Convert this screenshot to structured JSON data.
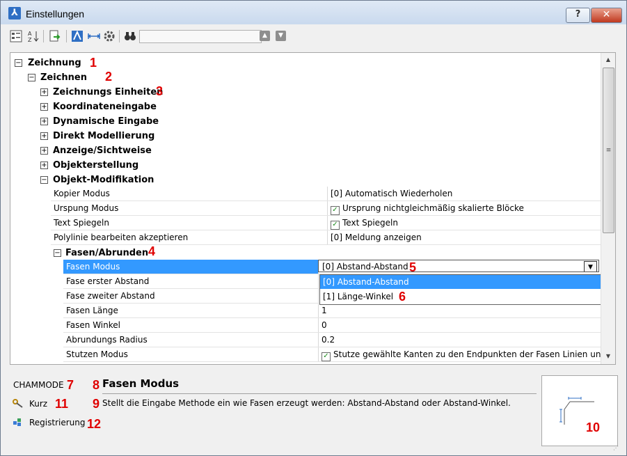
{
  "window": {
    "title": "Einstellungen",
    "help_label": "?",
    "close_label": "✕"
  },
  "toolbar": {
    "icons": [
      "categorized-view-icon",
      "alphabetic-sort-icon",
      "export-icon",
      "draw-settings-icon",
      "dimension-icon",
      "gear-icon",
      "binoculars-icon"
    ],
    "search_value": "",
    "up_label": "▲",
    "down_label": "▼"
  },
  "tree": {
    "zeichnung": "Zeichnung",
    "zeichnen": "Zeichnen",
    "zeichnungs_einheiten": "Zeichnungs Einheiten",
    "koordinateneingabe": "Koordinateneingabe",
    "dynamische_eingabe": "Dynamische Eingabe",
    "direkt_modellierung": "Direkt Modellierung",
    "anzeige": "Anzeige/Sichtweise",
    "objekterstellung": "Objekterstellung",
    "objekt_modifikation": "Objekt-Modifikation",
    "fasen_abrunden": "Fasen/Abrunden",
    "expanders": {
      "minus": "−",
      "plus": "+"
    }
  },
  "properties": {
    "kopier_modus": {
      "name": "Kopier Modus",
      "value": "[0] Automatisch Wiederholen"
    },
    "ursprung_modus": {
      "name": "Urspung Modus",
      "value": "Ursprung nichtgleichmäßig skalierte Blöcke",
      "checked": true
    },
    "text_spiegeln": {
      "name": "Text Spiegeln",
      "value": "Text Spiegeln",
      "checked": true
    },
    "polylinie": {
      "name": "Polylinie bearbeiten akzeptieren",
      "value": "[0] Meldung anzeigen"
    },
    "fasen_modus": {
      "name": "Fasen Modus",
      "value": "[0] Abstand-Abstand"
    },
    "fase_erster": {
      "name": "Fase erster Abstand",
      "value": ""
    },
    "fase_zweiter": {
      "name": "Fase zweiter Abstand",
      "value": ""
    },
    "fasen_laenge": {
      "name": "Fasen Länge",
      "value": "1"
    },
    "fasen_winkel": {
      "name": "Fasen Winkel",
      "value": "0"
    },
    "abrundungs_radius": {
      "name": "Abrundungs Radius",
      "value": "0.2"
    },
    "stutzen_modus": {
      "name": "Stutzen Modus",
      "value": "Stutze gewählte Kanten zu den Endpunkten der Fasen Linien und A",
      "checked": true
    }
  },
  "dropdown": {
    "options": [
      "[0] Abstand-Abstand",
      "[1] Länge-Winkel"
    ],
    "selected_index": 0,
    "button_label": "▼"
  },
  "scrollbar": {
    "up": "▲",
    "down": "▼",
    "thumb_grip": "≡"
  },
  "annotations": [
    "1",
    "2",
    "3",
    "4",
    "5",
    "6",
    "7",
    "8",
    "9",
    "10",
    "11",
    "12"
  ],
  "bottom": {
    "variable_name": "CHAMMODE",
    "description_title": "Fasen Modus",
    "description_text": "Stellt die Eingabe Methode ein wie Fasen erzeugt werden: Abstand-Abstand oder Abstand-Winkel.",
    "kurz_label": "Kurz",
    "registrierung_label": "Registrierung",
    "resize_grip": "⋰"
  },
  "colors": {
    "selection": "#3399ff",
    "annotation": "#e00000",
    "close_button": "#c0391f"
  }
}
